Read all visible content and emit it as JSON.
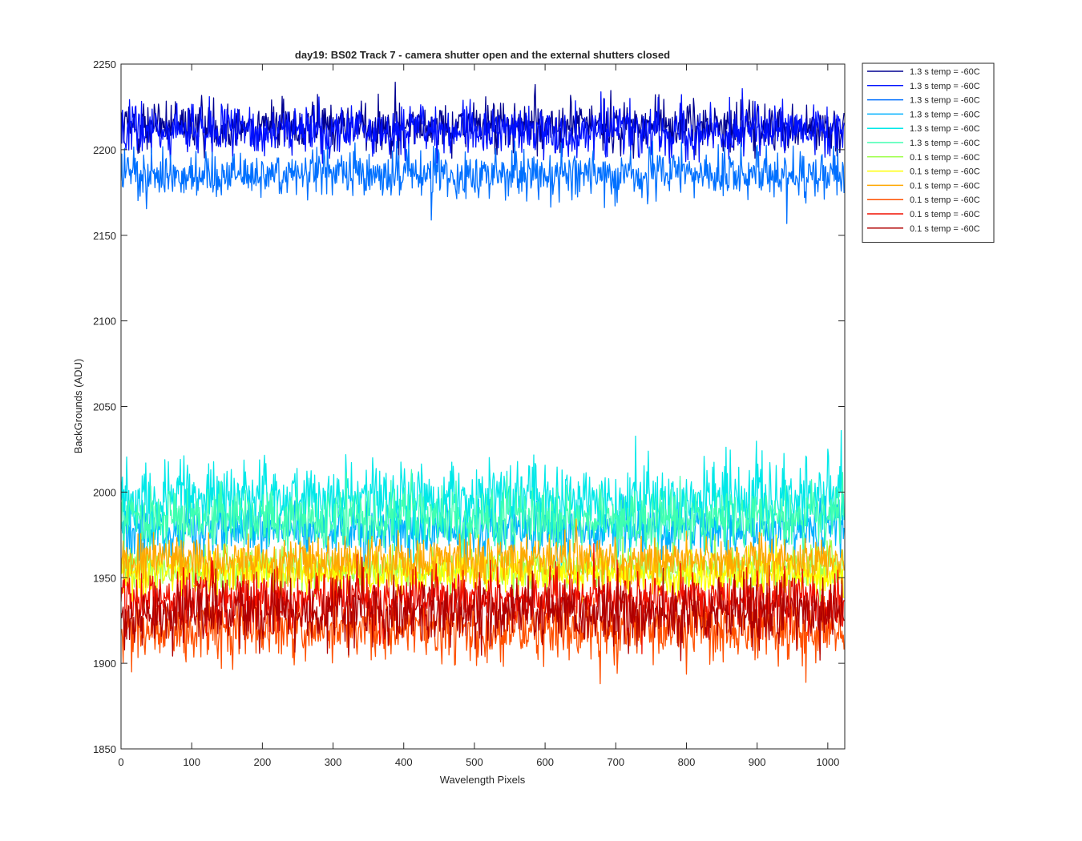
{
  "chart_data": {
    "type": "line",
    "title": "day19: BS02  Track 7 - camera shutter open and the external shutters closed",
    "xlabel": "Wavelength Pixels",
    "ylabel": "BackGrounds (ADU)",
    "xlim": [
      0,
      1024
    ],
    "ylim": [
      1850,
      2250
    ],
    "xticks": [
      0,
      100,
      200,
      300,
      400,
      500,
      600,
      700,
      800,
      900,
      1000
    ],
    "yticks": [
      1850,
      1900,
      1950,
      2000,
      2050,
      2100,
      2150,
      2200,
      2250
    ],
    "grid": false,
    "legend_position": "outside-top-right",
    "samples_per_series": 1024,
    "series": [
      {
        "name": "1.3 s temp = -60C",
        "color": "#000090",
        "mean": 2214,
        "noise": 7,
        "min": 2195,
        "max": 2242
      },
      {
        "name": "1.3 s temp = -60C",
        "color": "#0010ff",
        "mean": 2211,
        "noise": 7,
        "min": 2192,
        "max": 2238
      },
      {
        "name": "1.3 s temp = -60C",
        "color": "#0070ff",
        "mean": 2186,
        "noise": 7,
        "min": 2153,
        "max": 2205
      },
      {
        "name": "1.3 s temp = -60C",
        "color": "#00b0ff",
        "mean": 1978,
        "noise": 8,
        "min": 1950,
        "max": 2010
      },
      {
        "name": "1.3 s temp = -60C",
        "color": "#00e8e8",
        "mean": 1996,
        "noise": 11,
        "min": 1955,
        "max": 2052
      },
      {
        "name": "1.3 s temp = -60C",
        "color": "#40ffb0",
        "mean": 1985,
        "noise": 9,
        "min": 1950,
        "max": 2025
      },
      {
        "name": "0.1 s temp = -60C",
        "color": "#a0ff50",
        "mean": 1955,
        "noise": 6,
        "min": 1935,
        "max": 1980
      },
      {
        "name": "0.1 s temp = -60C",
        "color": "#ffff00",
        "mean": 1952,
        "noise": 6,
        "min": 1930,
        "max": 1975
      },
      {
        "name": "0.1 s temp = -60C",
        "color": "#ffa800",
        "mean": 1960,
        "noise": 7,
        "min": 1938,
        "max": 1985
      },
      {
        "name": "0.1 s temp = -60C",
        "color": "#ff5000",
        "mean": 1920,
        "noise": 9,
        "min": 1865,
        "max": 1950
      },
      {
        "name": "0.1 s temp = -60C",
        "color": "#f01000",
        "mean": 1938,
        "noise": 8,
        "min": 1905,
        "max": 1972
      },
      {
        "name": "0.1 s temp = -60C",
        "color": "#b00000",
        "mean": 1930,
        "noise": 9,
        "min": 1880,
        "max": 1962
      }
    ]
  }
}
